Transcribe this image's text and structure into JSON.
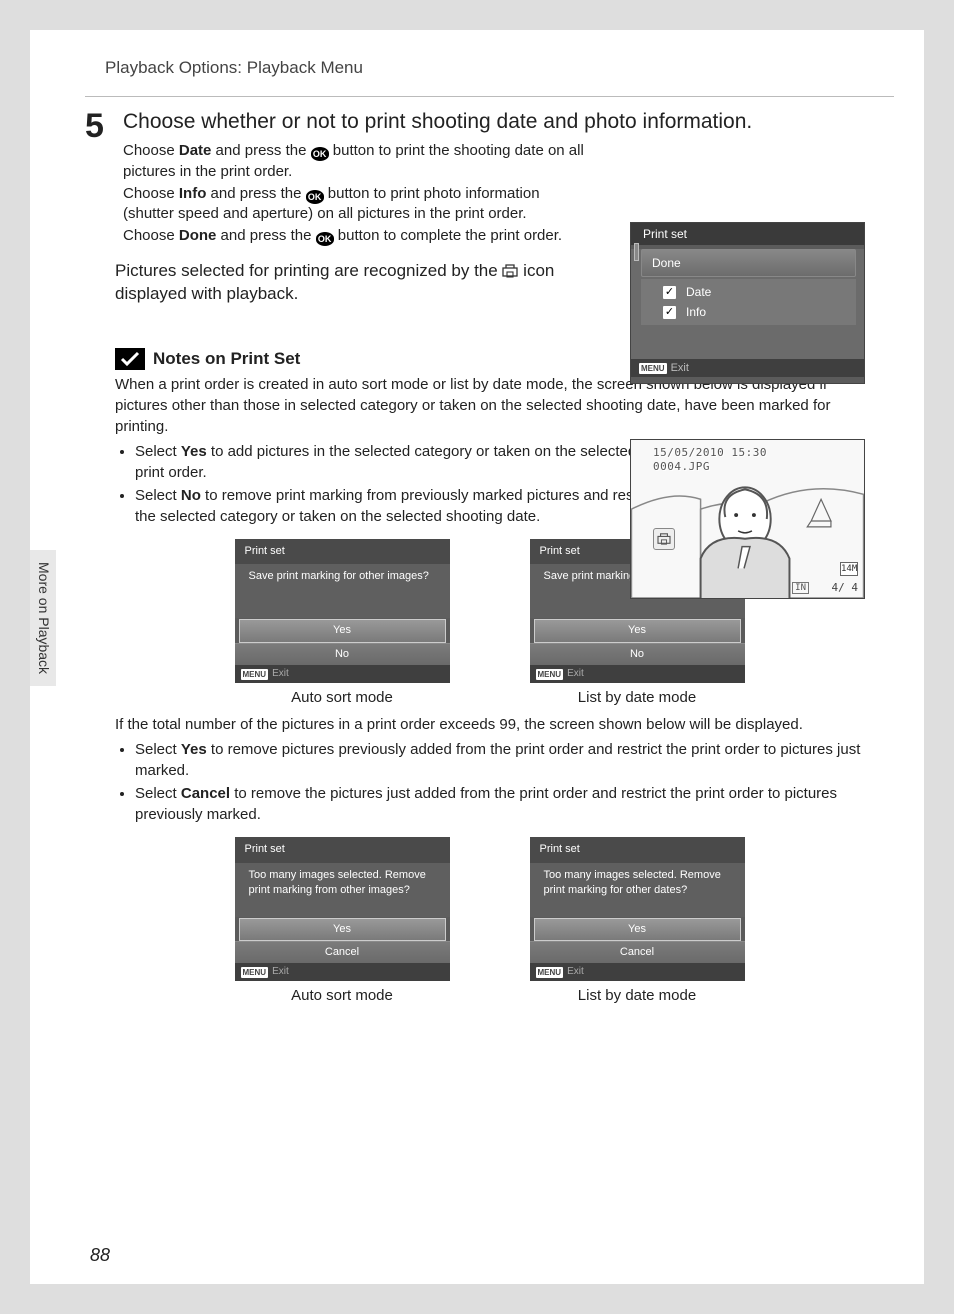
{
  "header": "Playback Options: Playback Menu",
  "sidebar_label": "More on Playback",
  "page_number": "88",
  "step": {
    "num": "5",
    "title": "Choose whether or not to print shooting date and photo information.",
    "p1a": "Choose ",
    "p1b": "Date",
    "p1c": " and press the ",
    "p1d": " button to print the shooting date on all pictures in the print order.",
    "p2a": "Choose ",
    "p2b": "Info",
    "p2c": " and press the ",
    "p2d": " button to print photo information (shutter speed and aperture) on all pictures in the print order.",
    "p3a": "Choose ",
    "p3b": "Done",
    "p3c": " and press the ",
    "p3d": " button to complete the print order."
  },
  "ok_label": "OK",
  "after_text_a": "Pictures selected for printing are recognized by the ",
  "after_text_b": " icon displayed with playback.",
  "screen1": {
    "title": "Print set",
    "done": "Done",
    "date": "Date",
    "info": "Info",
    "menu": "MENU",
    "exit": "Exit"
  },
  "photo": {
    "date": "15/05/2010 15:30",
    "file": "0004.JPG",
    "size": "14M",
    "count": "4/     4",
    "in": "IN"
  },
  "notes": {
    "title": "Notes on Print Set",
    "p1": "When a print order is created in auto sort mode or list by date mode, the screen shown below is displayed if pictures other than those in selected category or taken on the selected shooting date, have been marked for printing.",
    "li1a": "Select ",
    "li1b": "Yes",
    "li1c": " to add pictures in the selected category or taken on the selected shooting date, to the existing print order.",
    "li2a": "Select ",
    "li2b": "No",
    "li2c": " to remove print marking from previously marked pictures and restrict the print order to pictures in the selected category or taken on the selected shooting date.",
    "p2": "If the total number of the pictures in a print order exceeds 99, the screen shown below will be displayed.",
    "li3a": "Select ",
    "li3b": "Yes",
    "li3c": " to remove pictures previously added from the print order and restrict the print order to pictures just marked.",
    "li4a": "Select ",
    "li4b": "Cancel",
    "li4c": " to remove the pictures just added from the print order and restrict the print order to pictures previously marked."
  },
  "dialog1": {
    "title": "Print set",
    "msg": "Save print marking for other images?",
    "yes": "Yes",
    "no": "No",
    "menu": "MENU",
    "exit": "Exit",
    "cap": "Auto sort mode"
  },
  "dialog2": {
    "title": "Print set",
    "msg": "Save print marking for other dates?",
    "yes": "Yes",
    "no": "No",
    "menu": "MENU",
    "exit": "Exit",
    "cap": "List by date mode"
  },
  "dialog3": {
    "title": "Print set",
    "msg": "Too many images selected. Remove print marking from other images?",
    "yes": "Yes",
    "no": "Cancel",
    "menu": "MENU",
    "exit": "Exit",
    "cap": "Auto sort mode"
  },
  "dialog4": {
    "title": "Print set",
    "msg": "Too many images selected. Remove print marking for other dates?",
    "yes": "Yes",
    "no": "Cancel",
    "menu": "MENU",
    "exit": "Exit",
    "cap": "List by date mode"
  }
}
